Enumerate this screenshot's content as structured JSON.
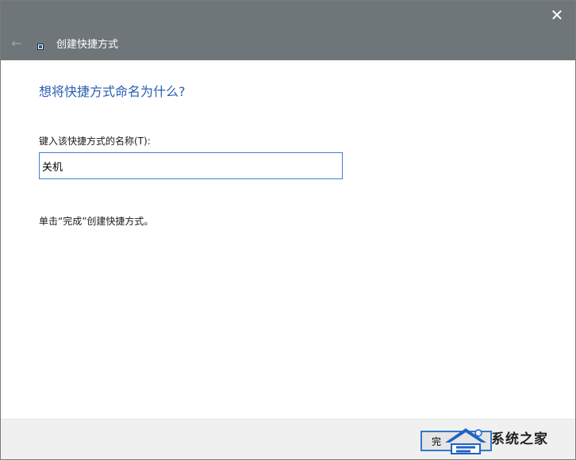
{
  "window": {
    "title": "创建快捷方式",
    "close_glyph": "✕",
    "back_glyph": "←",
    "icons": {
      "close": "close-icon",
      "back": "back-arrow-icon",
      "app": "shortcut-app-icon"
    }
  },
  "content": {
    "heading": "想将快捷方式命名为什么?",
    "field_label": "键入该快捷方式的名称(T):",
    "name_value": "关机",
    "hint": "单击“完成”创建快捷方式。"
  },
  "footer": {
    "finish_label": "完"
  },
  "watermark": {
    "text": "系统之家",
    "icon": "system-home-logo-icon"
  },
  "colors": {
    "titlebar": "#6f7679",
    "heading": "#2a5db0",
    "input_border": "#3c80d8",
    "footer": "#f0f0f0",
    "logo_blue": "#1e63c4"
  }
}
